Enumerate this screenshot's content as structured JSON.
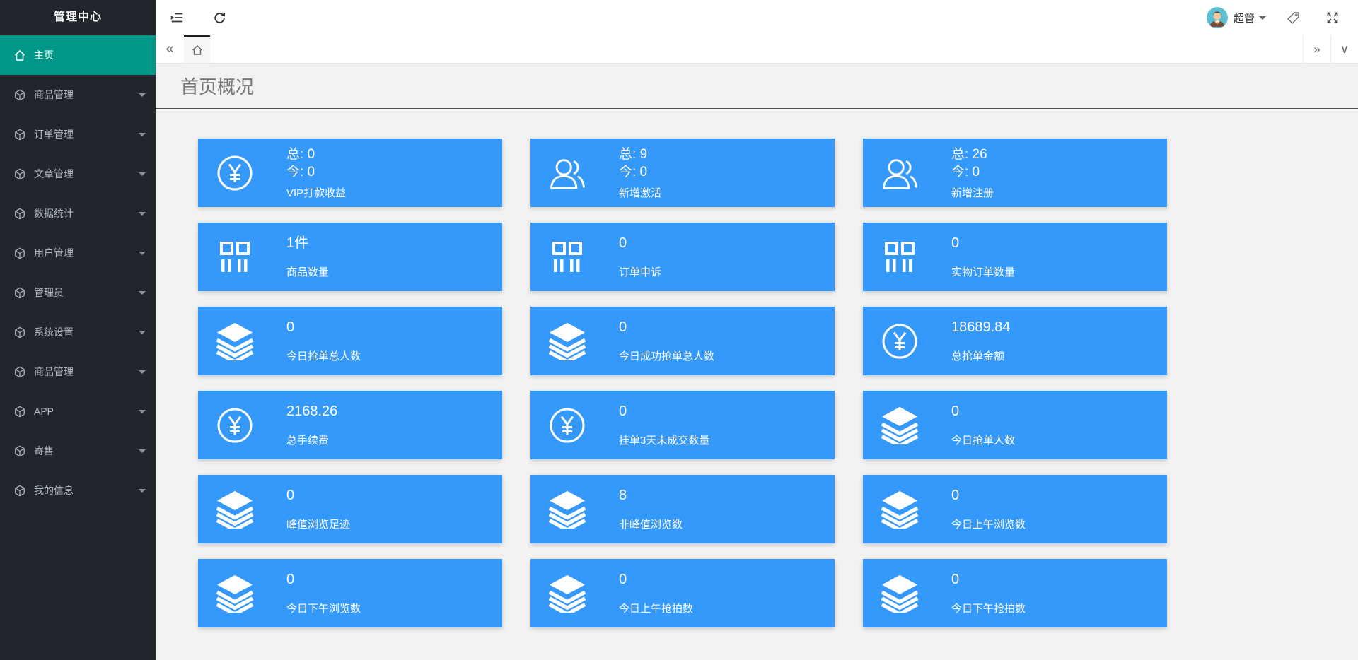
{
  "colors": {
    "card_blue": "#3598fb",
    "sidebar_bg": "#21252c",
    "active_teal": "#009688",
    "content_bg": "#f2f2f2",
    "title_color": "#757575"
  },
  "sidebar": {
    "title": "管理中心",
    "home": {
      "label": "主页",
      "icon": "home-icon"
    },
    "items": [
      {
        "label": "商品管理",
        "icon": "cube-icon"
      },
      {
        "label": "订单管理",
        "icon": "cube-icon"
      },
      {
        "label": "文章管理",
        "icon": "cube-icon"
      },
      {
        "label": "数据统计",
        "icon": "cube-icon"
      },
      {
        "label": "用户管理",
        "icon": "cube-icon"
      },
      {
        "label": "管理员",
        "icon": "cube-icon"
      },
      {
        "label": "系统设置",
        "icon": "cube-icon"
      },
      {
        "label": "商品管理",
        "icon": "cube-icon"
      },
      {
        "label": "APP",
        "icon": "cube-icon"
      },
      {
        "label": "寄售",
        "icon": "cube-icon"
      },
      {
        "label": "我的信息",
        "icon": "cube-icon"
      }
    ]
  },
  "header": {
    "icons": [
      "menu-collapse-icon",
      "refresh-icon"
    ],
    "user": {
      "name": "超管",
      "avatar": "avatar-person"
    },
    "right_icons": [
      "tag-icon",
      "fullscreen-icon"
    ]
  },
  "tabbar": {
    "scroll_left": "«",
    "home_tab": "home-icon",
    "scroll_right": "»",
    "collapse": "∨"
  },
  "page": {
    "title": "首页概况"
  },
  "cards": [
    {
      "icon": "yen-circle-icon",
      "lines": [
        "总: 0",
        "今: 0"
      ],
      "label": "VIP打款收益"
    },
    {
      "icon": "users-icon",
      "lines": [
        "总: 9",
        "今: 0"
      ],
      "label": "新增激活"
    },
    {
      "icon": "users-icon",
      "lines": [
        "总: 26",
        "今: 0"
      ],
      "label": "新增注册"
    },
    {
      "icon": "goods-icon",
      "value": "1件",
      "label": "商品数量"
    },
    {
      "icon": "goods-icon",
      "value": "0",
      "label": "订单申诉"
    },
    {
      "icon": "goods-icon",
      "value": "0",
      "label": "实物订单数量"
    },
    {
      "icon": "layers-icon",
      "value": "0",
      "label": "今日抢单总人数"
    },
    {
      "icon": "layers-icon",
      "value": "0",
      "label": "今日成功抢单总人数"
    },
    {
      "icon": "yen-circle-icon",
      "value": "18689.84",
      "label": "总抢单金额"
    },
    {
      "icon": "yen-circle-icon",
      "value": "2168.26",
      "label": "总手续费"
    },
    {
      "icon": "yen-circle-icon",
      "value": "0",
      "label": "挂单3天未成交数量"
    },
    {
      "icon": "layers-icon",
      "value": "0",
      "label": "今日抢单人数"
    },
    {
      "icon": "layers-icon",
      "value": "0",
      "label": "峰值浏览足迹"
    },
    {
      "icon": "layers-icon",
      "value": "8",
      "label": "非峰值浏览数"
    },
    {
      "icon": "layers-icon",
      "value": "0",
      "label": "今日上午浏览数"
    },
    {
      "icon": "layers-icon",
      "value": "0",
      "label": "今日下午浏览数"
    },
    {
      "icon": "layers-icon",
      "value": "0",
      "label": "今日上午抢拍数"
    },
    {
      "icon": "layers-icon",
      "value": "0",
      "label": "今日下午抢拍数"
    }
  ]
}
